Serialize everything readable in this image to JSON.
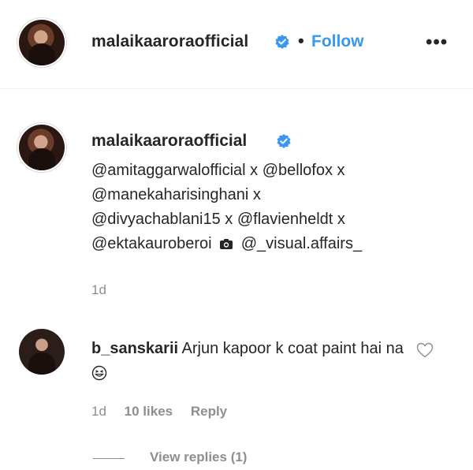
{
  "header": {
    "username": "malaikaaroraofficial",
    "separator": "•",
    "follow_label": "Follow",
    "more_label": "•••"
  },
  "caption": {
    "username": "malaikaaroraofficial",
    "mentions": {
      "m1": "@amitaggarwalofficial",
      "x1": " x ",
      "m2": "@bellofox",
      "x2": " x",
      "m3": "@manekaharisinghani",
      "x3": " x",
      "m4": "@divyachablani15",
      "x4": " x ",
      "m5": "@flavienheldt",
      "x5": " x",
      "m6": "@ektakauroberoi",
      "m7": "@_visual.affairs_"
    },
    "time": "1d"
  },
  "comment": {
    "username": "b_sanskarii",
    "text": " Arjun kapoor k coat paint hai na",
    "time": "1d",
    "likes": "10 likes",
    "reply_label": "Reply",
    "view_replies": "View replies (1)"
  },
  "colors": {
    "link": "#3897f0",
    "text": "#262626",
    "muted": "#8e8e8e",
    "verified": "#3897f0"
  }
}
